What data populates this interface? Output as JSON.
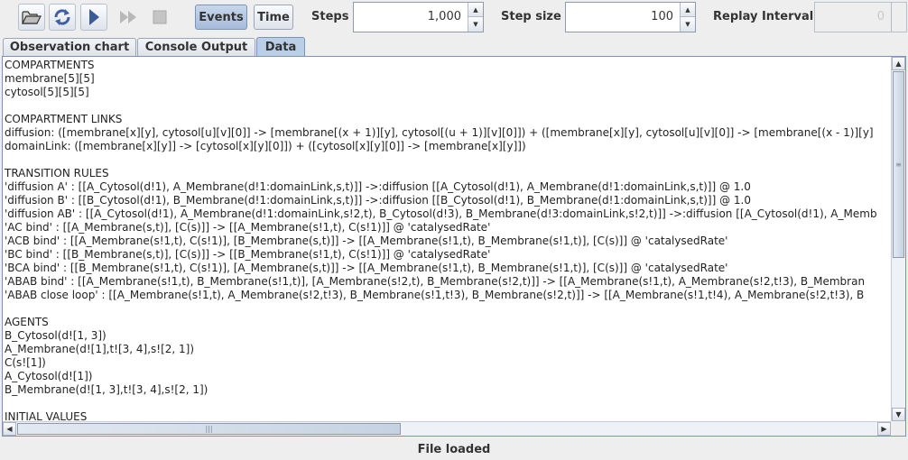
{
  "toolbar": {
    "buttons": [
      {
        "name": "open-folder-icon"
      },
      {
        "name": "reload-icon"
      },
      {
        "name": "play-icon"
      },
      {
        "name": "fast-forward-icon"
      },
      {
        "name": "stop-icon"
      }
    ],
    "events_label": "Events",
    "time_label": "Time",
    "steps_label": "Steps",
    "steps_value": "1,000",
    "step_size_label": "Step size",
    "step_size_value": "100",
    "replay_label": "Replay Interval",
    "replay_value": "0"
  },
  "tabs": [
    {
      "label": "Observation chart"
    },
    {
      "label": "Console Output"
    },
    {
      "label": "Data"
    }
  ],
  "data_lines": [
    "COMPARTMENTS",
    "membrane[5][5]",
    "cytosol[5][5][5]",
    "",
    "COMPARTMENT LINKS",
    "diffusion: ([membrane[x][y], cytosol[u][v][0]] -> [membrane[(x + 1)][y], cytosol[(u + 1)][v][0]]) + ([membrane[x][y], cytosol[u][v][0]] -> [membrane[(x - 1)][y]",
    "domainLink: ([membrane[x][y]] -> [cytosol[x][y][0]]) + ([cytosol[x][y][0]] -> [membrane[x][y]])",
    "",
    "TRANSITION RULES",
    "'diffusion A' : [[A_Cytosol(d!1), A_Membrane(d!1:domainLink,s,t)]] ->:diffusion [[A_Cytosol(d!1), A_Membrane(d!1:domainLink,s,t)]] @ 1.0",
    "'diffusion B' : [[B_Cytosol(d!1), B_Membrane(d!1:domainLink,s,t)]] ->:diffusion [[B_Cytosol(d!1), B_Membrane(d!1:domainLink,s,t)]] @ 1.0",
    "'diffusion AB' : [[A_Cytosol(d!1), A_Membrane(d!1:domainLink,s!2,t), B_Cytosol(d!3), B_Membrane(d!3:domainLink,s!2,t)]] ->:diffusion [[A_Cytosol(d!1), A_Memb",
    "'AC bind' : [[A_Membrane(s,t)], [C(s)]] -> [[A_Membrane(s!1,t), C(s!1)]] @ 'catalysedRate'",
    "'ACB bind' : [[A_Membrane(s!1,t), C(s!1)], [B_Membrane(s,t)]] -> [[A_Membrane(s!1,t), B_Membrane(s!1,t)], [C(s)]] @ 'catalysedRate'",
    "'BC bind' : [[B_Membrane(s,t)], [C(s)]] -> [[B_Membrane(s!1,t), C(s!1)]] @ 'catalysedRate'",
    "'BCA bind' : [[B_Membrane(s!1,t), C(s!1)], [A_Membrane(s,t)]] -> [[A_Membrane(s!1,t), B_Membrane(s!1,t)], [C(s)]] @ 'catalysedRate'",
    "'ABAB bind' : [[A_Membrane(s!1,t), B_Membrane(s!1,t)], [A_Membrane(s!2,t), B_Membrane(s!2,t)]] -> [[A_Membrane(s!1,t), A_Membrane(s!2,t!3), B_Membran",
    "'ABAB close loop' : [[A_Membrane(s!1,t), A_Membrane(s!2,t!3), B_Membrane(s!1,t!3), B_Membrane(s!2,t)]] -> [[A_Membrane(s!1,t!4), A_Membrane(s!2,t!3), B",
    "",
    "AGENTS",
    "B_Cytosol(d![1, 3])",
    "A_Membrane(d![1],t![3, 4],s![2, 1])",
    "C(s![1])",
    "A_Cytosol(d![1])",
    "B_Membrane(d![1, 3],t![3, 4],s![2, 1])",
    "",
    "INITIAL VALUES"
  ],
  "status": "File loaded",
  "colors": {
    "active_toggle": "#b4c8e4",
    "active_tab": "#b8cfe5",
    "panel_border": "#7d93b3"
  }
}
